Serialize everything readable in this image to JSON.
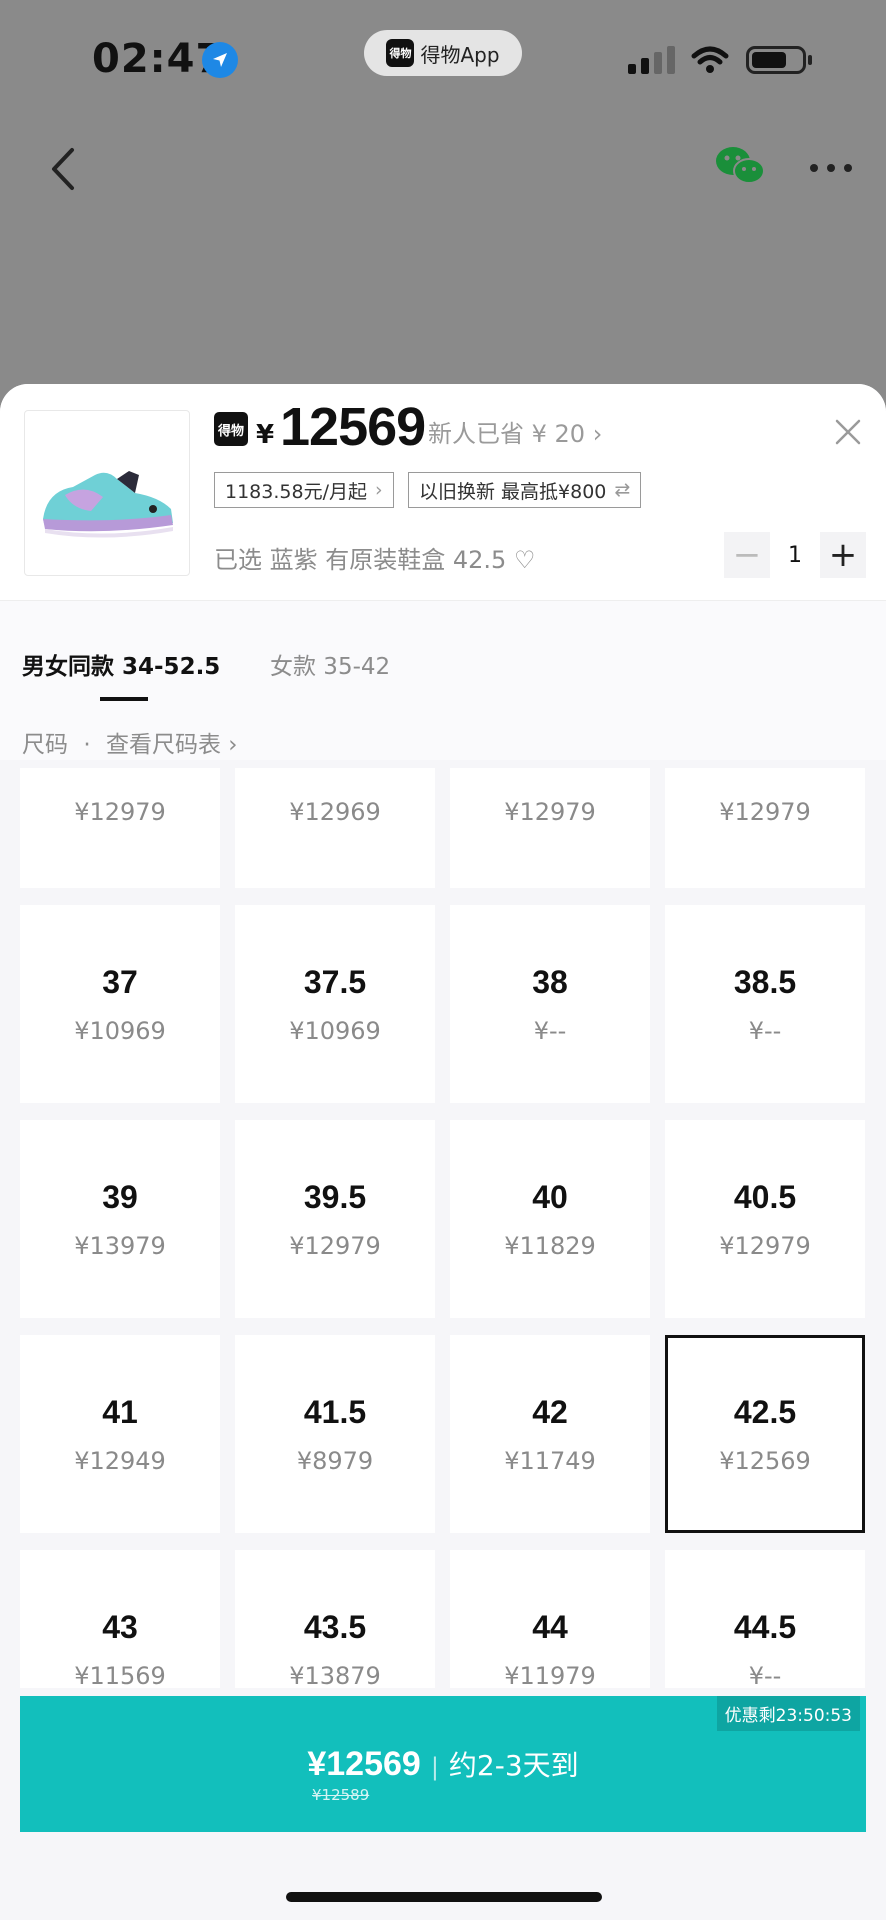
{
  "status": {
    "time": "02:47",
    "app_name": "得物App",
    "app_logo_text": "得物"
  },
  "product": {
    "logo_text": "得物",
    "currency": "¥",
    "price": "12569",
    "saved_text": "新人已省 ¥ 20",
    "installment": "1183.58元/月起",
    "trade_in": "以旧换新 最高抵¥800",
    "selected": "已选 蓝紫 有原装鞋盒 42.5",
    "quantity": "1"
  },
  "tabs": {
    "men": "男女同款 34-52.5",
    "women": "女款 35-42"
  },
  "size_header": {
    "label": "尺码",
    "chart_link": "查看尺码表"
  },
  "partial_row": [
    "¥12979",
    "¥12969",
    "¥12979",
    "¥12979"
  ],
  "sizes": [
    {
      "size": "37",
      "price": "¥10969"
    },
    {
      "size": "37.5",
      "price": "¥10969"
    },
    {
      "size": "38",
      "price": "¥--"
    },
    {
      "size": "38.5",
      "price": "¥--"
    },
    {
      "size": "39",
      "price": "¥13979"
    },
    {
      "size": "39.5",
      "price": "¥12979"
    },
    {
      "size": "40",
      "price": "¥11829"
    },
    {
      "size": "40.5",
      "price": "¥12979"
    },
    {
      "size": "41",
      "price": "¥12949"
    },
    {
      "size": "41.5",
      "price": "¥8979"
    },
    {
      "size": "42",
      "price": "¥11749"
    },
    {
      "size": "42.5",
      "price": "¥12569",
      "selected": true
    },
    {
      "size": "43",
      "price": "¥11569"
    },
    {
      "size": "43.5",
      "price": "¥13879"
    },
    {
      "size": "44",
      "price": "¥11979"
    },
    {
      "size": "44.5",
      "price": "¥--"
    }
  ],
  "buy": {
    "countdown": "优惠剩23:50:53",
    "price": "¥12569",
    "eta": "约2-3天到",
    "original": "¥12589"
  },
  "colors": {
    "accent": "#12bfbc",
    "accent_dark": "#0ea5a2",
    "selected_border": "#111111"
  }
}
